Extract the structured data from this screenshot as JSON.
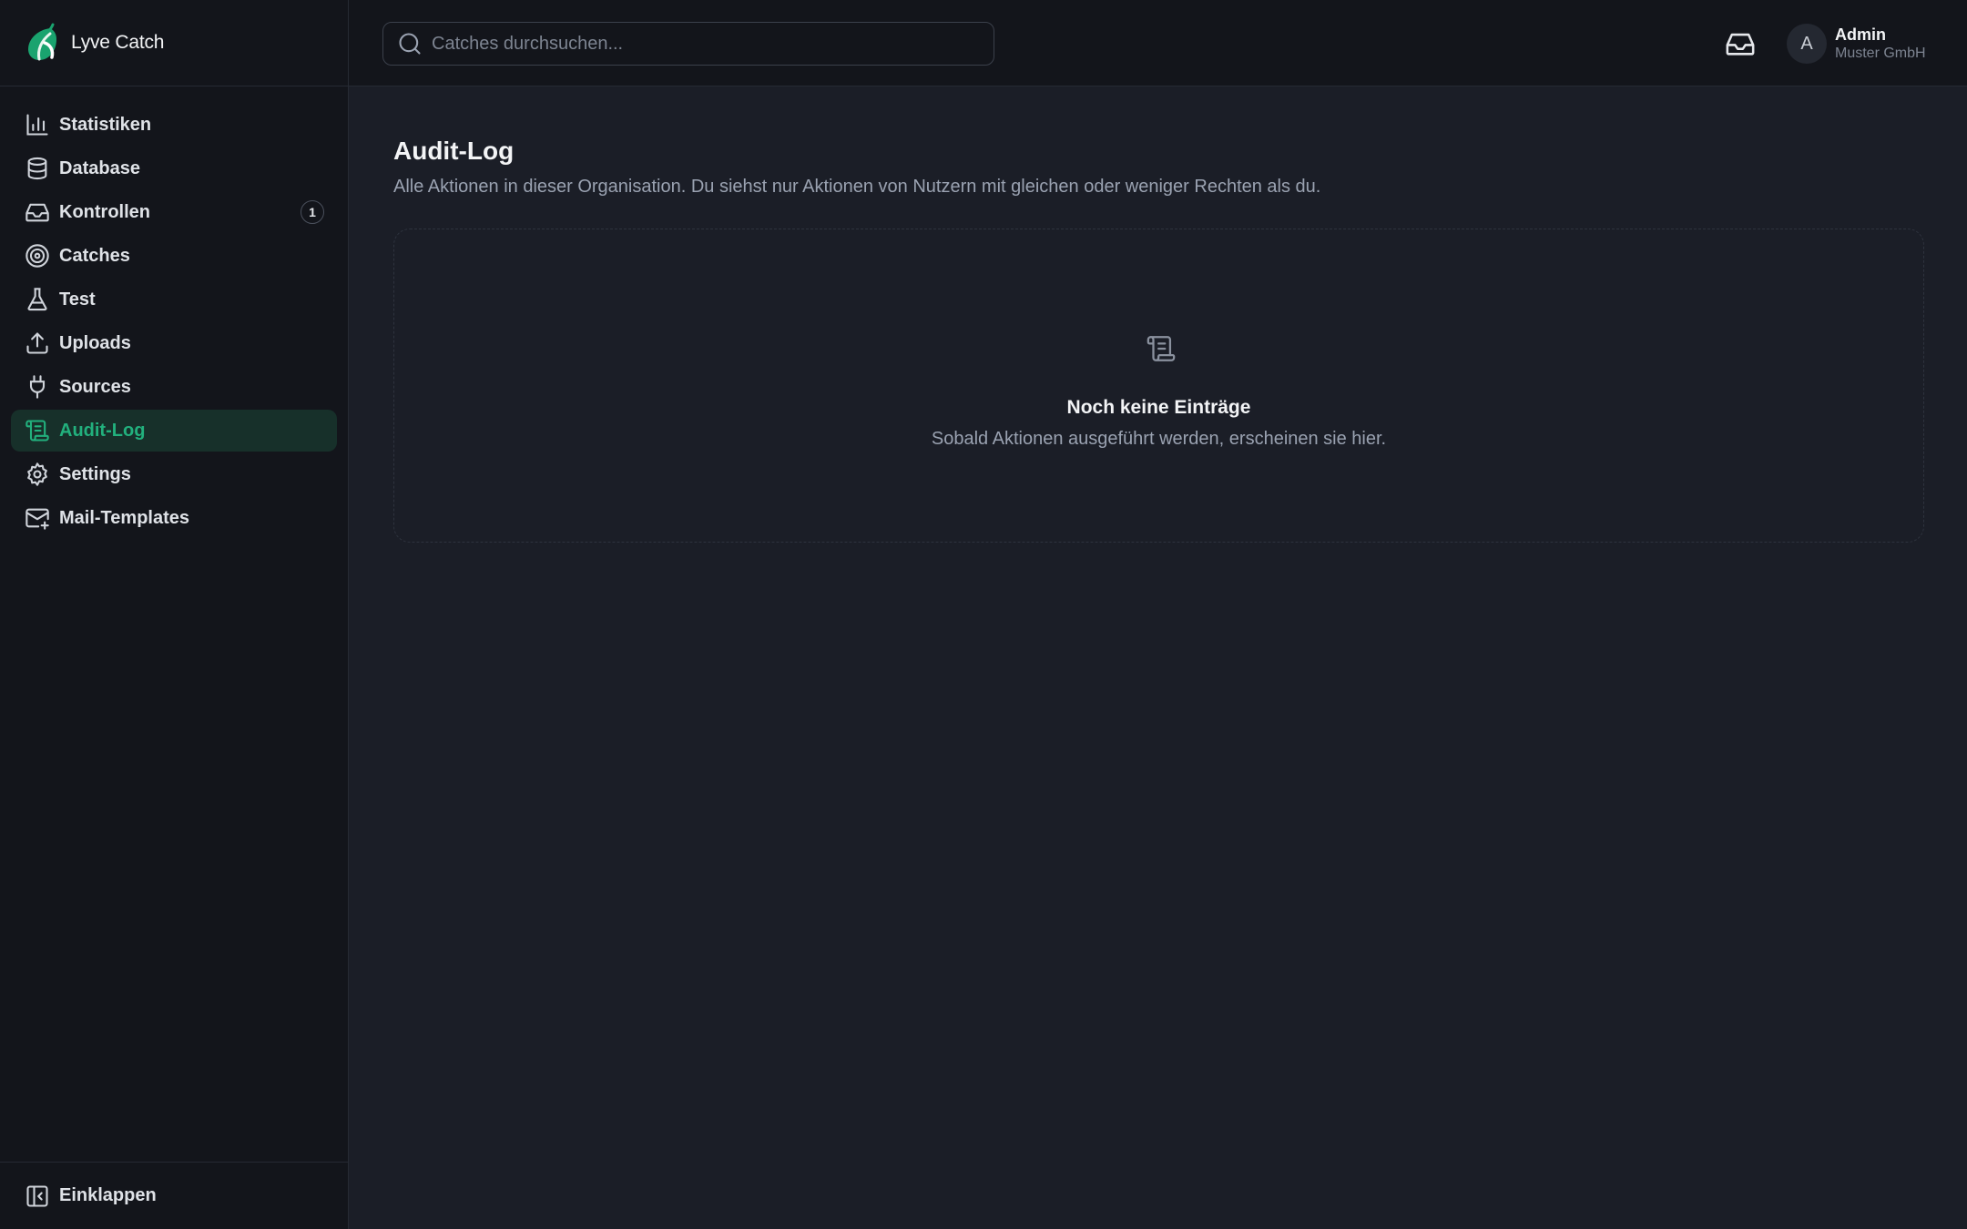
{
  "brand": {
    "name": "Lyve Catch",
    "accent": "#22b07d"
  },
  "sidebar": {
    "items": [
      {
        "label": "Statistiken",
        "icon": "bar-chart-icon"
      },
      {
        "label": "Database",
        "icon": "database-icon"
      },
      {
        "label": "Kontrollen",
        "icon": "inbox-icon",
        "badge": "1"
      },
      {
        "label": "Catches",
        "icon": "target-icon"
      },
      {
        "label": "Test",
        "icon": "flask-icon"
      },
      {
        "label": "Uploads",
        "icon": "upload-icon"
      },
      {
        "label": "Sources",
        "icon": "plug-icon"
      },
      {
        "label": "Audit-Log",
        "icon": "scroll-icon",
        "active": true
      },
      {
        "label": "Settings",
        "icon": "gear-icon"
      },
      {
        "label": "Mail-Templates",
        "icon": "mail-plus-icon"
      }
    ],
    "collapse_label": "Einklappen"
  },
  "topbar": {
    "search_placeholder": "Catches durchsuchen...",
    "user": {
      "avatar_letter": "A",
      "name": "Admin",
      "org": "Muster GmbH"
    }
  },
  "main": {
    "title": "Audit-Log",
    "subtitle": "Alle Aktionen in dieser Organisation. Du siehst nur Aktionen von Nutzern mit gleichen oder weniger Rechten als du.",
    "empty": {
      "title": "Noch keine Einträge",
      "text": "Sobald Aktionen ausgeführt werden, erscheinen sie hier."
    }
  }
}
